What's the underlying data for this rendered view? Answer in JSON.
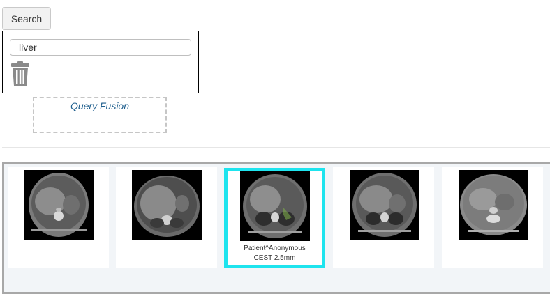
{
  "search": {
    "button_label": "Search"
  },
  "query": {
    "value": "liver",
    "delete_icon": "trash-icon"
  },
  "fusion": {
    "label": "Query Fusion"
  },
  "gallery": {
    "selected_index": 2,
    "selected_color": "#1ee4ee",
    "items": [
      {
        "variant": "ct-axial-upper-abdomen"
      },
      {
        "variant": "ct-axial-liver"
      },
      {
        "variant": "ct-axial-liver-segmented",
        "patient": "Patient^Anonymous",
        "series": "CEST 2.5mm"
      },
      {
        "variant": "ct-axial-upper-abdomen"
      },
      {
        "variant": "ct-axial-lower-abdomen"
      }
    ]
  }
}
